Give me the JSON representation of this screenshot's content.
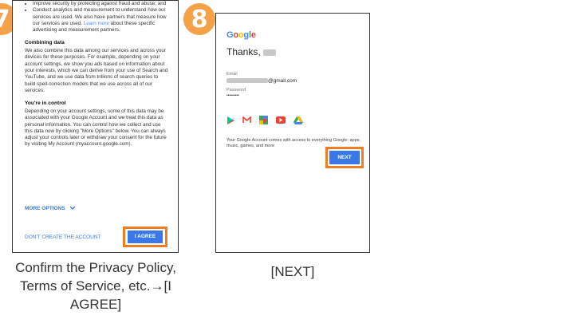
{
  "step7": {
    "badge": "7",
    "bullets": [
      "Improve security by protecting against fraud and abuse; and",
      "Conduct analytics and measurement to understand how our services are used. We also have partners that measure how our services are used."
    ],
    "learn_more": "Learn more",
    "learn_more_tail": " about these specific advertising and measurement partners.",
    "combining_heading": "Combining data",
    "combining_text": "We also combine this data among our services and across your devices for these purposes. For example, depending on your account settings, we show you ads based on information about your interests, which we can derive from your use of Search and YouTube, and we use data from trillions of search queries to build spell-correction models that we use across all of our services.",
    "control_heading": "You're in control",
    "control_text": "Depending on your account settings, some of this data may be associated with your Google Account and we treat this data as personal information. You can control how we collect and use this data now by clicking \"More Options\" below. You can always adjust your controls later or withdraw your consent for the future by visiting My Account (myaccount.google.com).",
    "more_options": "MORE OPTIONS",
    "dont_create": "DON'T CREATE THE ACCOUNT",
    "agree": "I AGREE",
    "caption": "Confirm the Privacy Policy, Terms of Service, etc.→[I AGREE]"
  },
  "step8": {
    "badge": "8",
    "logo": [
      "G",
      "o",
      "o",
      "g",
      "l",
      "e"
    ],
    "logo_colors": [
      "#4285F4",
      "#EA4335",
      "#FBBC05",
      "#4285F4",
      "#34A853",
      "#EA4335"
    ],
    "thanks": "Thanks,",
    "email_label": "Email",
    "email_suffix": "@gmail.com",
    "password_label": "Password",
    "password_value": "•••••••••",
    "icons": [
      "play-store-icon",
      "gmail-icon",
      "maps-icon",
      "youtube-icon",
      "drive-icon"
    ],
    "description": "Your Google Account comes with access to everything Google: apps, music, games, and more",
    "next": "NEXT",
    "caption": "[NEXT]"
  }
}
